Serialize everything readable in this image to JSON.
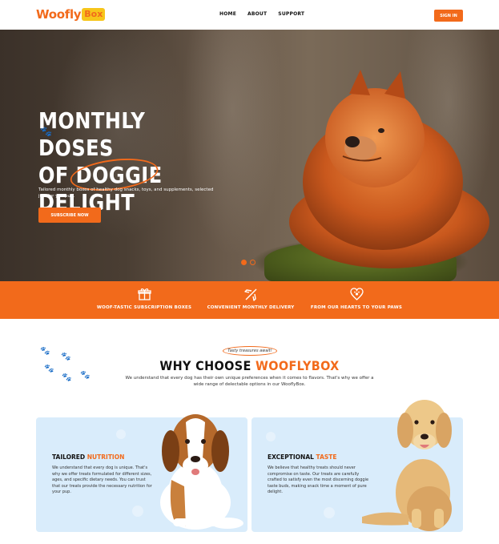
{
  "header": {
    "logo_word": "Woofly",
    "logo_box": "Box",
    "nav": [
      "HOME",
      "ABOUT",
      "SUPPORT"
    ],
    "signin_label": "SIGN IN"
  },
  "hero": {
    "title_line1": "MONTHLY DOSES",
    "title_line2_prefix": "OF ",
    "title_line2_highlight": "DOGGIE",
    "title_line3": "DELIGHT",
    "subtitle": "Tailored monthly boxes of healthy dog snacks, toys, and supplements, selected just for you pup.",
    "cta_label": "SUBSCRIBE NOW"
  },
  "features": [
    {
      "icon": "gift-box-icon",
      "label": "WOOF-TASTIC SUBSCRIPTION BOXES"
    },
    {
      "icon": "airplane-icon",
      "label": "CONVENIENT MONTHLY DELIVERY"
    },
    {
      "icon": "heart-paw-icon",
      "label": "FROM OUR HEARTS TO YOUR PAWS"
    }
  ],
  "why": {
    "tag": "Tasty treasures await!",
    "title_prefix": "WHY CHOOSE ",
    "title_accent": "WOOFLYBOX",
    "description": "We understand that every dog has their own unique preferences when it comes to flavors. That's why we offer a wide range of delectable options in our WooflyBox."
  },
  "cards": [
    {
      "title_prefix": "TAILORED ",
      "title_accent": "NUTRITION",
      "text": "We understand that every dog is unique. That's why we offer treats formulated for different sizes, ages, and specific dietary needs. You can trust that our treats provide the necessary nutrition for your pup."
    },
    {
      "title_prefix": "EXCEPTIONAL ",
      "title_accent": "TASTE",
      "text": "We believe that healthy treats should never compromise on taste. Our treats are carefully crafted to satisfy even the most discerning doggie taste buds, making snack time a moment of pure delight."
    }
  ],
  "colors": {
    "accent": "#f26a1b",
    "logo_box": "#f7c51a",
    "card_bg": "#d9ecfb"
  }
}
